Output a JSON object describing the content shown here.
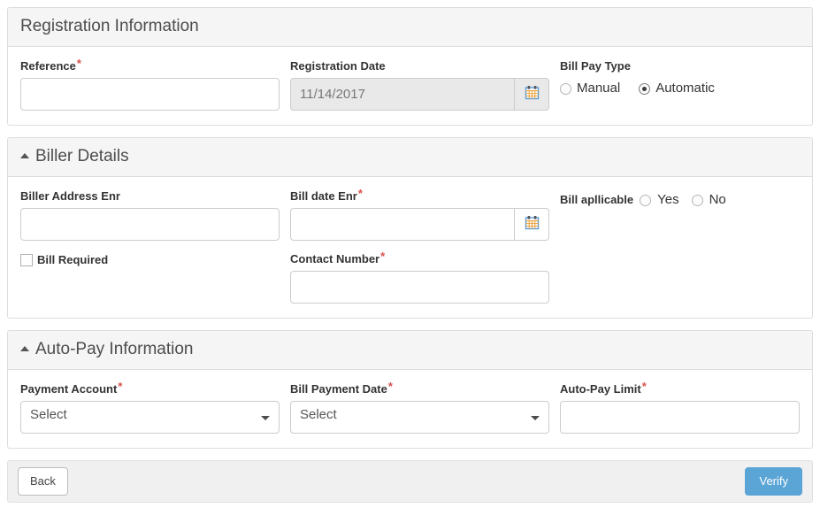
{
  "colors": {
    "accent": "#5ba4d6",
    "required_star": "#d9534f",
    "panel_header_bg": "#f5f5f5",
    "panel_border": "#dddddd",
    "footer_bg": "#f0f0f0",
    "disabled_bg": "#e9e9e9"
  },
  "registration_panel": {
    "title": "Registration Information",
    "reference": {
      "label": "Reference",
      "required": "*",
      "value": "",
      "placeholder": ""
    },
    "registration_date": {
      "label": "Registration Date",
      "value": "11/14/2017",
      "placeholder": "",
      "calendar_icon": "calendar-icon"
    },
    "bill_pay_type": {
      "label": "Bill Pay Type",
      "options": [
        {
          "label": "Manual",
          "selected": false
        },
        {
          "label": "Automatic",
          "selected": true
        }
      ]
    }
  },
  "biller_panel": {
    "title": "Biller Details",
    "collapse_icon": "caret-up-icon",
    "biller_address": {
      "label": "Biller Address Enr",
      "value": "",
      "placeholder": ""
    },
    "bill_date": {
      "label": "Bill date Enr",
      "required": "*",
      "value": "",
      "placeholder": "",
      "calendar_icon": "calendar-icon"
    },
    "bill_applicable": {
      "label": "Bill apllicable",
      "options": [
        {
          "label": "Yes",
          "selected": false
        },
        {
          "label": "No",
          "selected": false
        }
      ]
    },
    "bill_required": {
      "label": "Bill Required",
      "checked": false
    },
    "contact_number": {
      "label": "Contact Number",
      "required": "*",
      "value": "",
      "placeholder": ""
    }
  },
  "autopay_panel": {
    "title": "Auto-Pay Information",
    "collapse_icon": "caret-up-icon",
    "payment_account": {
      "label": "Payment Account",
      "required": "*",
      "selected": "Select",
      "options": [
        "Select"
      ]
    },
    "bill_payment_date": {
      "label": "Bill Payment Date",
      "required": "*",
      "selected": "Select",
      "options": [
        "Select"
      ]
    },
    "autopay_limit": {
      "label": "Auto-Pay Limit",
      "required": "*",
      "value": "",
      "placeholder": ""
    }
  },
  "footer": {
    "back_label": "Back",
    "verify_label": "Verify"
  }
}
